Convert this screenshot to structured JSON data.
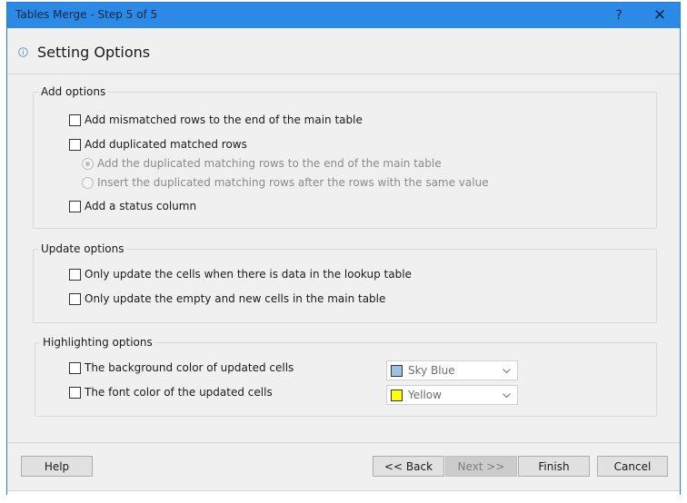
{
  "window": {
    "title": "Tables Merge - Step 5 of 5",
    "help_glyph": "?",
    "close_glyph": "✕"
  },
  "header": {
    "title": "Setting Options"
  },
  "add_options": {
    "title": "Add options",
    "mismatched": "Add mismatched rows to the end of the main table",
    "duplicated": "Add duplicated matched rows",
    "dup_end": "Add the duplicated matching rows to the end of the main table",
    "dup_after": "Insert the duplicated matching rows after the rows with the same value",
    "status_column": "Add a status column"
  },
  "update_options": {
    "title": "Update options",
    "only_lookup": "Only update the cells when there is data in the lookup table",
    "only_empty": "Only update the empty and new cells in the main table"
  },
  "highlighting_options": {
    "title": "Highlighting options",
    "background": "The background color of updated cells",
    "font": "The font color of the updated cells",
    "background_color_name": "Sky Blue",
    "background_color_hex": "#9cc3e6",
    "font_color_name": "Yellow",
    "font_color_hex": "#ffff00"
  },
  "buttons": {
    "help": "Help",
    "back": "<< Back",
    "next": "Next >>",
    "finish": "Finish",
    "cancel": "Cancel"
  },
  "theme": {
    "titlebar_color": "#2b8ae6",
    "dialog_bg": "#f0f0f0"
  }
}
